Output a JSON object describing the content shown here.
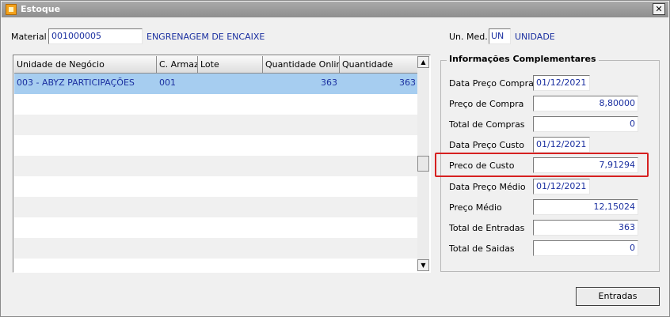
{
  "window": {
    "title": "Estoque",
    "close_glyph": "✕"
  },
  "material": {
    "label": "Material",
    "code": "001000005",
    "description": "ENGRENAGEM DE ENCAIXE",
    "unit_label": "Un. Med.",
    "unit_code": "UN",
    "unit_description": "UNIDADE"
  },
  "grid": {
    "columns": [
      "Unidade de Negócio",
      "C. Armaz.",
      "Lote",
      "Quantidade Online",
      "Quantidade"
    ],
    "rows": [
      {
        "unidade": "003 - ABYZ PARTICIPAÇÕES",
        "armaz": "001",
        "lote": "",
        "qtd_online": "363",
        "qtd": "363"
      }
    ]
  },
  "info": {
    "title": "Informações Complementares",
    "fields": [
      {
        "label": "Data Preço Compra",
        "value": "01/12/2021"
      },
      {
        "label": "Preço de Compra",
        "value": "8,80000"
      },
      {
        "label": "Total de Compras",
        "value": "0"
      },
      {
        "label": "Data Preço Custo",
        "value": "01/12/2021"
      },
      {
        "label": "Preco de Custo",
        "value": "7,91294"
      },
      {
        "label": "Data Preço Médio",
        "value": "01/12/2021"
      },
      {
        "label": "Preço Médio",
        "value": "12,15024"
      },
      {
        "label": "Total de Entradas",
        "value": "363"
      },
      {
        "label": "Total de Saidas",
        "value": "0"
      }
    ]
  },
  "buttons": {
    "entradas": "Entradas"
  },
  "colors": {
    "highlight": "#d62020",
    "selected_row": "#a6cdf0",
    "value_text": "#1a2fa0"
  }
}
